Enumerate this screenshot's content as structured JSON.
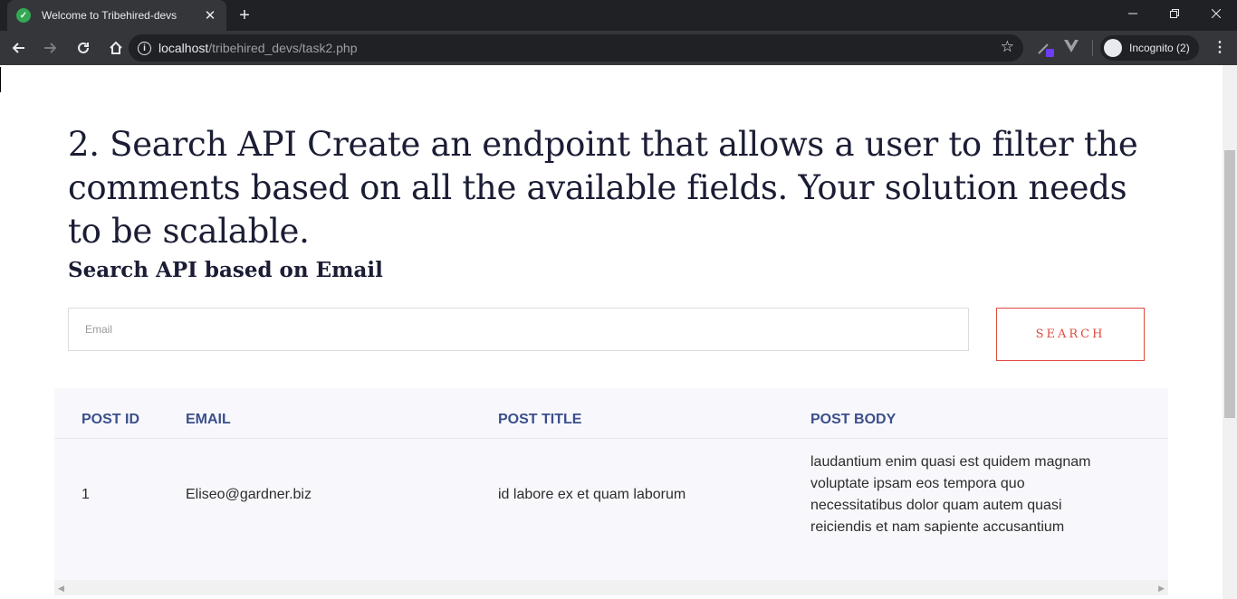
{
  "browser": {
    "tab_title": "Welcome to Tribehired-devs",
    "url_host": "localhost",
    "url_path": "/tribehired_devs/task2.php",
    "incognito_label": "Incognito (2)"
  },
  "page": {
    "heading": "2. Search API Create an endpoint that allows a user to filter the comments based on all the available fields. Your solution needs to be scalable.",
    "subheading": "Search API based on Email",
    "search": {
      "placeholder": "Email",
      "value": "",
      "button_label": "SEARCH"
    },
    "table": {
      "columns": [
        "POST ID",
        "EMAIL",
        "POST TITLE",
        "POST BODY"
      ],
      "rows": [
        {
          "post_id": "1",
          "email": "Eliseo@gardner.biz",
          "post_title": "id labore ex et quam laborum",
          "post_body": "laudantium enim quasi est quidem magnam voluptate ipsam eos tempora quo necessitatibus dolor quam autem quasi reiciendis et nam sapiente accusantium"
        }
      ]
    }
  },
  "colors": {
    "heading": "#1b1d35",
    "table_header": "#3b4f8c",
    "accent": "#e04a3f",
    "table_bg": "#f8f8fc"
  }
}
